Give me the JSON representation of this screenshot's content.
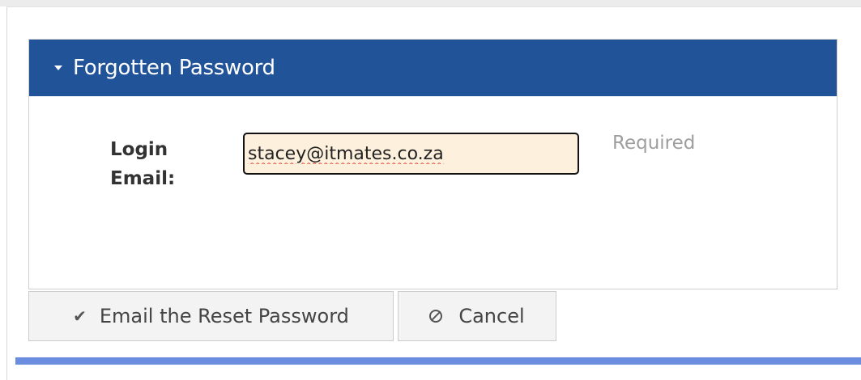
{
  "panel": {
    "title": "Forgotten Password",
    "header_color": "#215399",
    "caret_icon": "caret-down-icon"
  },
  "form": {
    "email_label_line1": "Login",
    "email_label_line2": "Email:",
    "email_value": "stacey@itmates.co.za",
    "required_text": "Required"
  },
  "buttons": {
    "reset_label": "Email the Reset Password",
    "reset_icon": "check-icon",
    "cancel_label": "Cancel",
    "cancel_icon": "cancel-circle-icon"
  },
  "theme": {
    "input_bg": "#fdf0dc",
    "bottom_bar": "#6b8de0"
  }
}
